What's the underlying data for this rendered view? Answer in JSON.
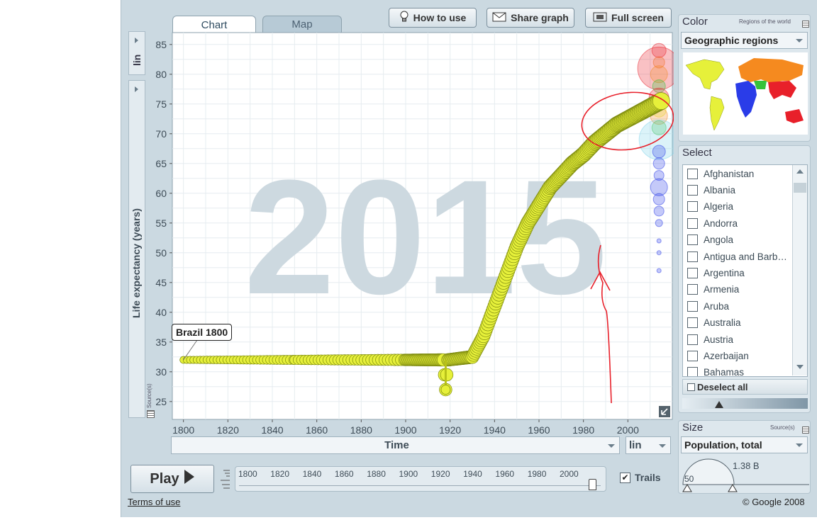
{
  "tabs": {
    "chart": "Chart",
    "map": "Map"
  },
  "toolbar": {
    "how_to_use": "How to use",
    "share_graph": "Share graph",
    "full_screen": "Full screen"
  },
  "y_axis": {
    "scale": "lin",
    "label": "Life expectancy (years)",
    "source": "Source(s)"
  },
  "x_axis": {
    "label": "Time",
    "scale": "lin"
  },
  "big_year": "2015",
  "bubble_label": "Brazil 1800",
  "color_panel": {
    "title": "Color",
    "subtitle": "Regions of the world",
    "selected": "Geographic regions"
  },
  "select_panel": {
    "title": "Select",
    "countries": [
      "Afghanistan",
      "Albania",
      "Algeria",
      "Andorra",
      "Angola",
      "Antigua and Barb…",
      "Argentina",
      "Armenia",
      "Aruba",
      "Australia",
      "Austria",
      "Azerbaijan",
      "Bahamas"
    ],
    "deselect": "Deselect all"
  },
  "size_panel": {
    "title": "Size",
    "source": "Source(s)",
    "selected": "Population, total",
    "max": "1.38 B",
    "min": "50"
  },
  "play": {
    "label": "Play",
    "trails": "Trails",
    "trails_checked": true
  },
  "timeline_ticks": [
    "1800",
    "1820",
    "1840",
    "1860",
    "1880",
    "1900",
    "1920",
    "1940",
    "1960",
    "1980",
    "2000"
  ],
  "footer": {
    "terms": "Terms of use",
    "copyright": "© Google 2008"
  },
  "colors": {
    "trail": "#e6f03a",
    "trail_stroke": "#7d8a10",
    "annotation": "#e8202a",
    "bg": "#cbd9e1"
  },
  "chart_data": {
    "type": "scatter",
    "xlabel": "Time",
    "ylabel": "Life expectancy (years)",
    "xlim": [
      1795,
      2020
    ],
    "ylim": [
      22,
      87
    ],
    "x_ticks": [
      "1800",
      "1820",
      "1840",
      "1860",
      "1880",
      "1900",
      "1920",
      "1940",
      "1960",
      "1980",
      "2000"
    ],
    "y_ticks": [
      "25",
      "30",
      "35",
      "40",
      "45",
      "50",
      "55",
      "60",
      "65",
      "70",
      "75",
      "80",
      "85"
    ],
    "grid": true,
    "series": [
      {
        "name": "Brazil",
        "x": [
          1800,
          1850,
          1900,
          1917,
          1918,
          1919,
          1930,
          1935,
          1940,
          1945,
          1950,
          1955,
          1960,
          1965,
          1970,
          1975,
          1980,
          1985,
          1990,
          1995,
          2000,
          2005,
          2010,
          2015
        ],
        "y": [
          32,
          32,
          32,
          32,
          27,
          32,
          32.5,
          36,
          41,
          46,
          51,
          55,
          58,
          61,
          63,
          65,
          66.5,
          68.5,
          70,
          71.5,
          72.5,
          73.5,
          74.5,
          75.5
        ]
      }
    ]
  }
}
